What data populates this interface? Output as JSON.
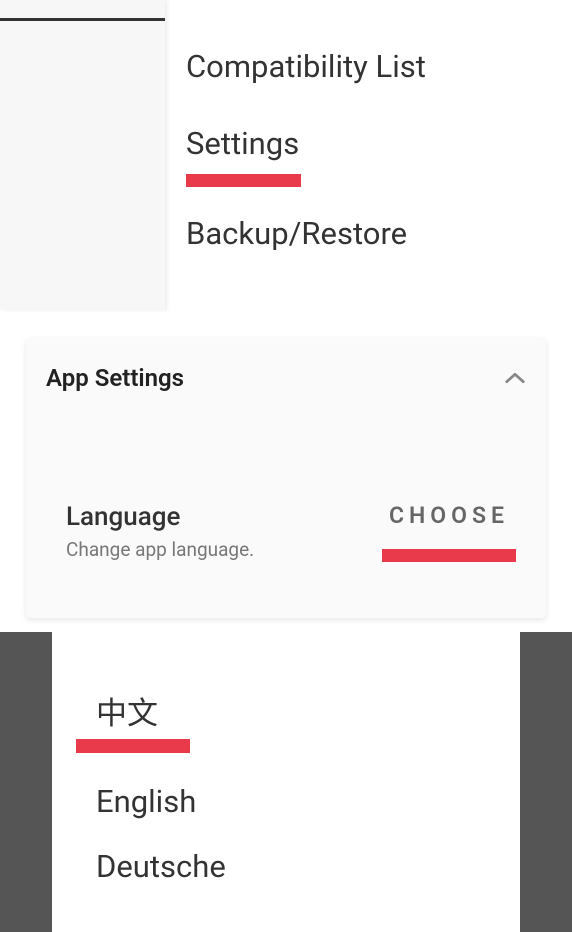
{
  "menu": {
    "compatibility": "Compatibility List",
    "settings": "Settings",
    "backup": "Backup/Restore"
  },
  "panel": {
    "title": "App Settings",
    "language": {
      "label": "Language",
      "desc": "Change app language.",
      "choose": "CHOOSE"
    }
  },
  "dialog": {
    "languages": [
      "中文",
      "English",
      "Deutsche"
    ]
  },
  "colors": {
    "accent": "#e83a4a"
  }
}
